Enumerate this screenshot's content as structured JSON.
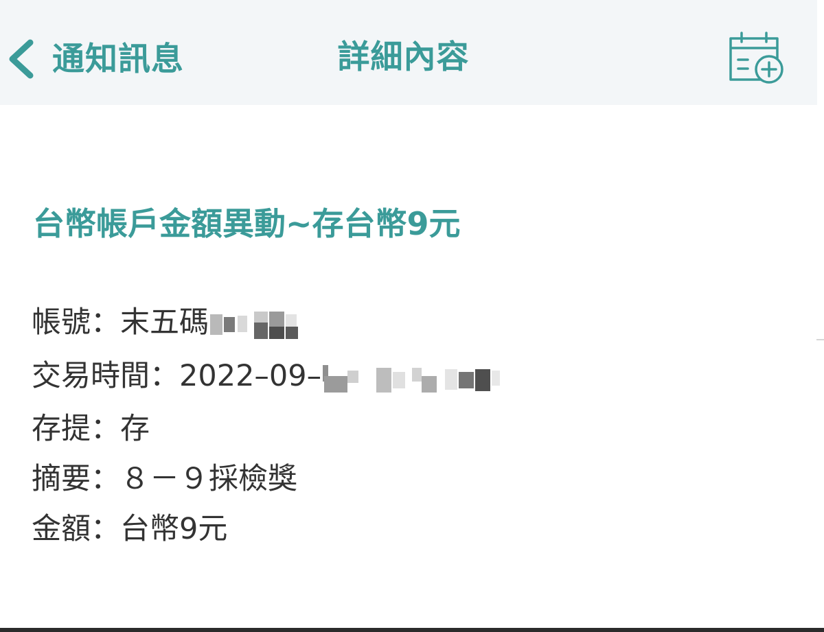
{
  "nav": {
    "back_label": "通知訊息",
    "title": "詳細內容",
    "back_icon": "chevron-left-icon",
    "action_icon": "calendar-add-icon"
  },
  "message": {
    "title": "台幣帳戶金額異動~存台幣9元",
    "account": {
      "label": "帳號：",
      "value": "末五碼"
    },
    "time": {
      "label": "交易時間：",
      "value": "2022–09–"
    },
    "type": {
      "label": "存提：",
      "value": "存"
    },
    "summary": {
      "label": "摘要：",
      "value": "８－９採檢獎"
    },
    "amount": {
      "label": "金額：",
      "value": "台幣9元"
    }
  },
  "colors": {
    "accent": "#3b9b99",
    "nav_background": "#f3f6f8",
    "text": "#333333"
  }
}
